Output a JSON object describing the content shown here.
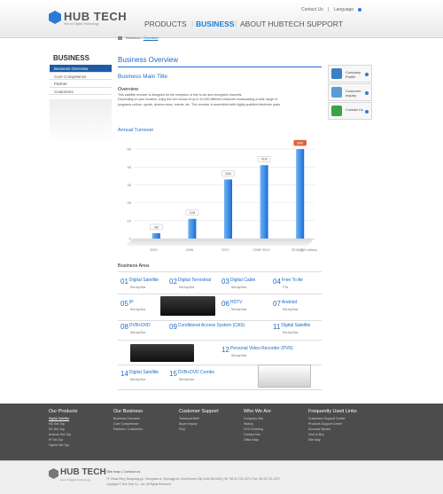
{
  "header": {
    "logo_text": "HUB TECH",
    "logo_tagline": "Hub of Digital Technology",
    "top_links": [
      "Contact Us",
      "|",
      "Language"
    ],
    "nav": [
      "PRODUCTS",
      "BUSINESS",
      "ABOUT HUBTECH",
      "SUPPORT"
    ],
    "nav_active": "BUSINESS"
  },
  "breadcrumb": [
    "Business",
    "/",
    "Overview"
  ],
  "sidebar": {
    "title": "BUSINESS",
    "items": [
      "Business Overview",
      "Core Competence",
      "Partner",
      "Customers"
    ],
    "active": "Business Overview"
  },
  "main": {
    "page_title": "Business Overview",
    "heading": "Business Main Title",
    "overview_label": "Overview",
    "overview_lines": [
      "This satellite receiver is designed for the reception of free to-air and encrypted channels.",
      "Depending on your location, enjoy the rich choice of up to 10,000 different channels broadcasting a wide range of",
      "programs culture, sports, cinema news, events, etc. This receiver is assembled with highly qualified electronic parts."
    ]
  },
  "right_panel": [
    {
      "label": "Company Profile",
      "icon": "person-icon",
      "color": "#3b7fc4"
    },
    {
      "label": "Customer Inquiry",
      "icon": "headset-person-icon",
      "color": "#5a9cd6"
    },
    {
      "label": "Contact Us",
      "icon": "contact-icon",
      "color": "#3aa24a"
    }
  ],
  "chart_data": {
    "type": "bar",
    "title": "Annual Turnover",
    "categories": [
      "2003",
      "2006",
      "2007",
      "2008~2012",
      "2013(E)"
    ],
    "values": [
      3,
      11,
      33,
      41,
      50
    ],
    "data_labels": [
      "3M",
      "11M",
      "33M",
      "41M",
      "50M"
    ],
    "yticks": [
      0,
      10,
      20,
      30,
      40,
      50
    ],
    "ylim": [
      0,
      55
    ],
    "unit_label": "(US dollars)",
    "highlight_last_color": "#e35d3a",
    "bar_color": "#3b8de6",
    "grid": true
  },
  "business_area": {
    "title": "Business Area",
    "items": [
      {
        "num": "01",
        "name": "Digital Satellite",
        "sub": "Set-top Box"
      },
      {
        "num": "02",
        "name": "Digital Terrestrial",
        "sub": "Set-top Box"
      },
      {
        "num": "03",
        "name": "Digital Cable",
        "sub": "Set-top Box"
      },
      {
        "num": "04",
        "name": "Free To Air",
        "sub": "FTA"
      },
      {
        "num": "05",
        "name": "IP",
        "sub": "Set-top Box"
      },
      {
        "num": "06",
        "name": "HDTV",
        "sub": "Set-top Box"
      },
      {
        "num": "07",
        "name": "Android",
        "sub": "Set-top Box"
      },
      {
        "num": "08",
        "name": "DVB+DVD",
        "sub": "Set-top Box"
      },
      {
        "num": "09",
        "name": "Conditional Access System (CAS)",
        "sub": ""
      },
      {
        "num": "10",
        "name": "Set-top Box",
        "sub": "Set-top Box"
      },
      {
        "num": "11",
        "name": "Digital Satellite",
        "sub": "Set-top Box"
      },
      {
        "num": "12",
        "name": "Personal Video Recorder (PVR)",
        "sub": "Set-top Box"
      },
      {
        "num": "14",
        "name": "Digital Satellite",
        "sub": "Set-top Box"
      },
      {
        "num": "15",
        "name": "DVB+DVD Combo",
        "sub": "Set-top Box"
      }
    ]
  },
  "footer": {
    "columns": [
      {
        "title": "Our Products",
        "links": [
          "Digital Satellite",
          "HD Set-Top",
          "SD Set-Top",
          "Android Set-Top",
          "IP Set-Top",
          "Hybrid Set-Top"
        ]
      },
      {
        "title": "Our Business",
        "links": [
          "Business Overview",
          "Core Competence",
          "Partners / Customers"
        ]
      },
      {
        "title": "Customer Support",
        "links": [
          "Technical Brief",
          "Buyer Inquiry",
          "FAQ"
        ]
      },
      {
        "title": "Who We Are",
        "links": [
          "Company Info",
          "History",
          "CEO Greeting",
          "Contact Info",
          "Office Map"
        ]
      },
      {
        "title": "Frequently Used Links",
        "links": [
          "Customers Support Center",
          "Products Support Center",
          "Success Stories",
          "How to Buy",
          "Site Map"
        ]
      }
    ],
    "bottom_links": [
      "Site map",
      "|",
      "Contact us"
    ],
    "address": "7F, Hwan-Ring, Bongdong-gu, Seongnam-si, Gyeonggi-do, South Korea (Zip Code 463-600)   |   Tel +82-31-701-1371   |   Fax +82-31-701-1371",
    "copyright": "Copyright © Hub Tech Co., Ltd. All Rights Reserved"
  }
}
